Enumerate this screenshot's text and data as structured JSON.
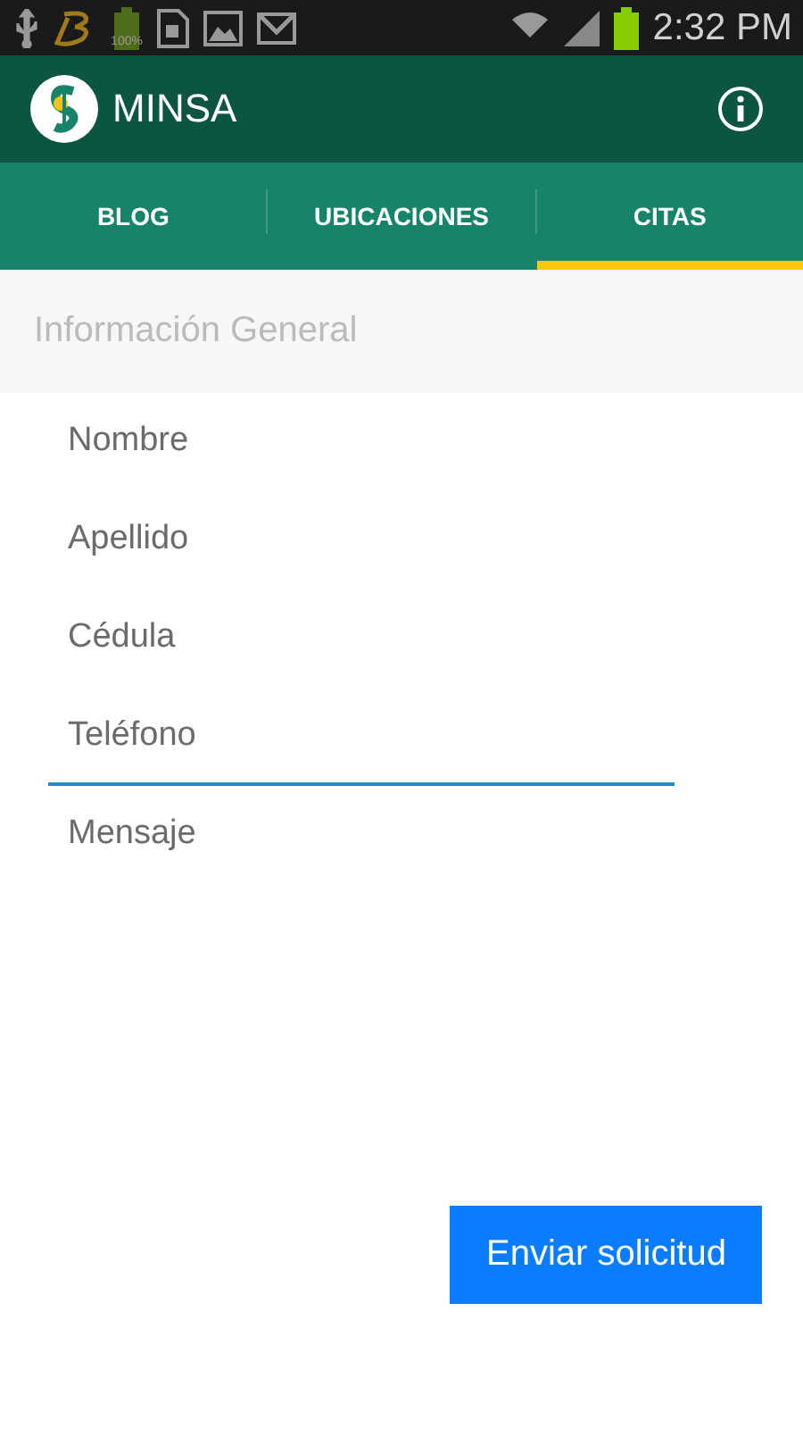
{
  "status_bar": {
    "battery_label": "100%",
    "time": "2:32 PM"
  },
  "app_bar": {
    "title": "MINSA"
  },
  "tabs": [
    {
      "label": "BLOG",
      "selected": false
    },
    {
      "label": "UBICACIONES",
      "selected": false
    },
    {
      "label": "CITAS",
      "selected": true
    }
  ],
  "section": {
    "title": "Información General"
  },
  "fields": [
    {
      "placeholder": "Nombre",
      "focused": false
    },
    {
      "placeholder": "Apellido",
      "focused": false
    },
    {
      "placeholder": "Cédula",
      "focused": false
    },
    {
      "placeholder": "Teléfono",
      "focused": true
    },
    {
      "placeholder": "Mensaje",
      "focused": false
    }
  ],
  "submit_button": {
    "label": "Enviar solicitud"
  }
}
